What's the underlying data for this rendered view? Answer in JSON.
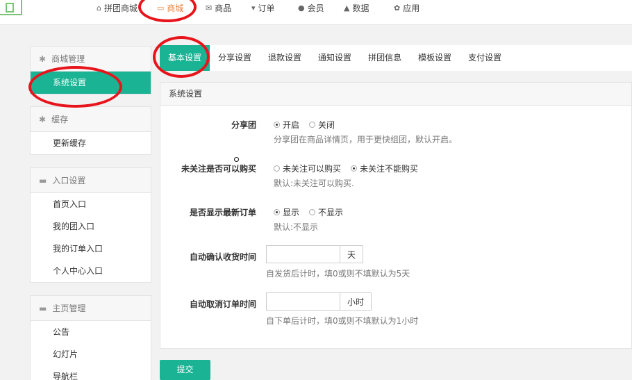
{
  "top_nav": {
    "items": [
      {
        "icon": "home-icon",
        "label": "拼团商城"
      },
      {
        "icon": "monitor-icon",
        "label": "商城"
      },
      {
        "icon": "gift-icon",
        "label": "商品"
      },
      {
        "icon": "cart-icon",
        "label": "订单"
      },
      {
        "icon": "user-icon",
        "label": "会员"
      },
      {
        "icon": "chart-icon",
        "label": "数据"
      },
      {
        "icon": "cogs-icon",
        "label": "应用"
      }
    ],
    "active": "商城",
    "active_color": "#e8843a"
  },
  "sidebar": {
    "groups": [
      {
        "title": "商城管理",
        "icon": "gear-icon",
        "items": [
          "系统设置"
        ]
      },
      {
        "title": "缓存",
        "icon": "gear-icon",
        "items": [
          "更新缓存"
        ]
      },
      {
        "title": "入口设置",
        "icon": "inbox-icon",
        "items": [
          "首页入口",
          "我的团入口",
          "我的订单入口",
          "个人中心入口"
        ]
      },
      {
        "title": "主页管理",
        "icon": "inbox-icon",
        "items": [
          "公告",
          "幻灯片",
          "导航栏"
        ]
      }
    ],
    "active_item": "系统设置"
  },
  "tabs": [
    "基本设置",
    "分享设置",
    "退款设置",
    "通知设置",
    "拼团信息",
    "模板设置",
    "支付设置"
  ],
  "active_tab": "基本设置",
  "card": {
    "title": "系统设置",
    "share_group": {
      "label": "分享团",
      "options": [
        "开启",
        "关闭"
      ],
      "selected": "开启",
      "help": "分享团在商品详情页，用于更快组团，默认开启。"
    },
    "follow_buy": {
      "label": "未关注是否可以购买",
      "options": [
        "未关注可以购买",
        "未关注不能购买"
      ],
      "selected": "未关注不能购买",
      "help": "默认:未关注可以购买."
    },
    "show_orders": {
      "label": "是否显示最新订单",
      "options": [
        "显示",
        "不显示"
      ],
      "selected": "显示",
      "help": "默认:不显示"
    },
    "auto_confirm": {
      "label": "自动确认收货时间",
      "value": "",
      "unit": "天",
      "help": "自发货后计时，填0或则不填默认为5天"
    },
    "auto_cancel": {
      "label": "自动取消订单时间",
      "value": "",
      "unit": "小时",
      "help": "自下单后计时，填0或则不填默认为1小时"
    }
  },
  "submit_label": "提交",
  "accent_color": "#1ab394"
}
